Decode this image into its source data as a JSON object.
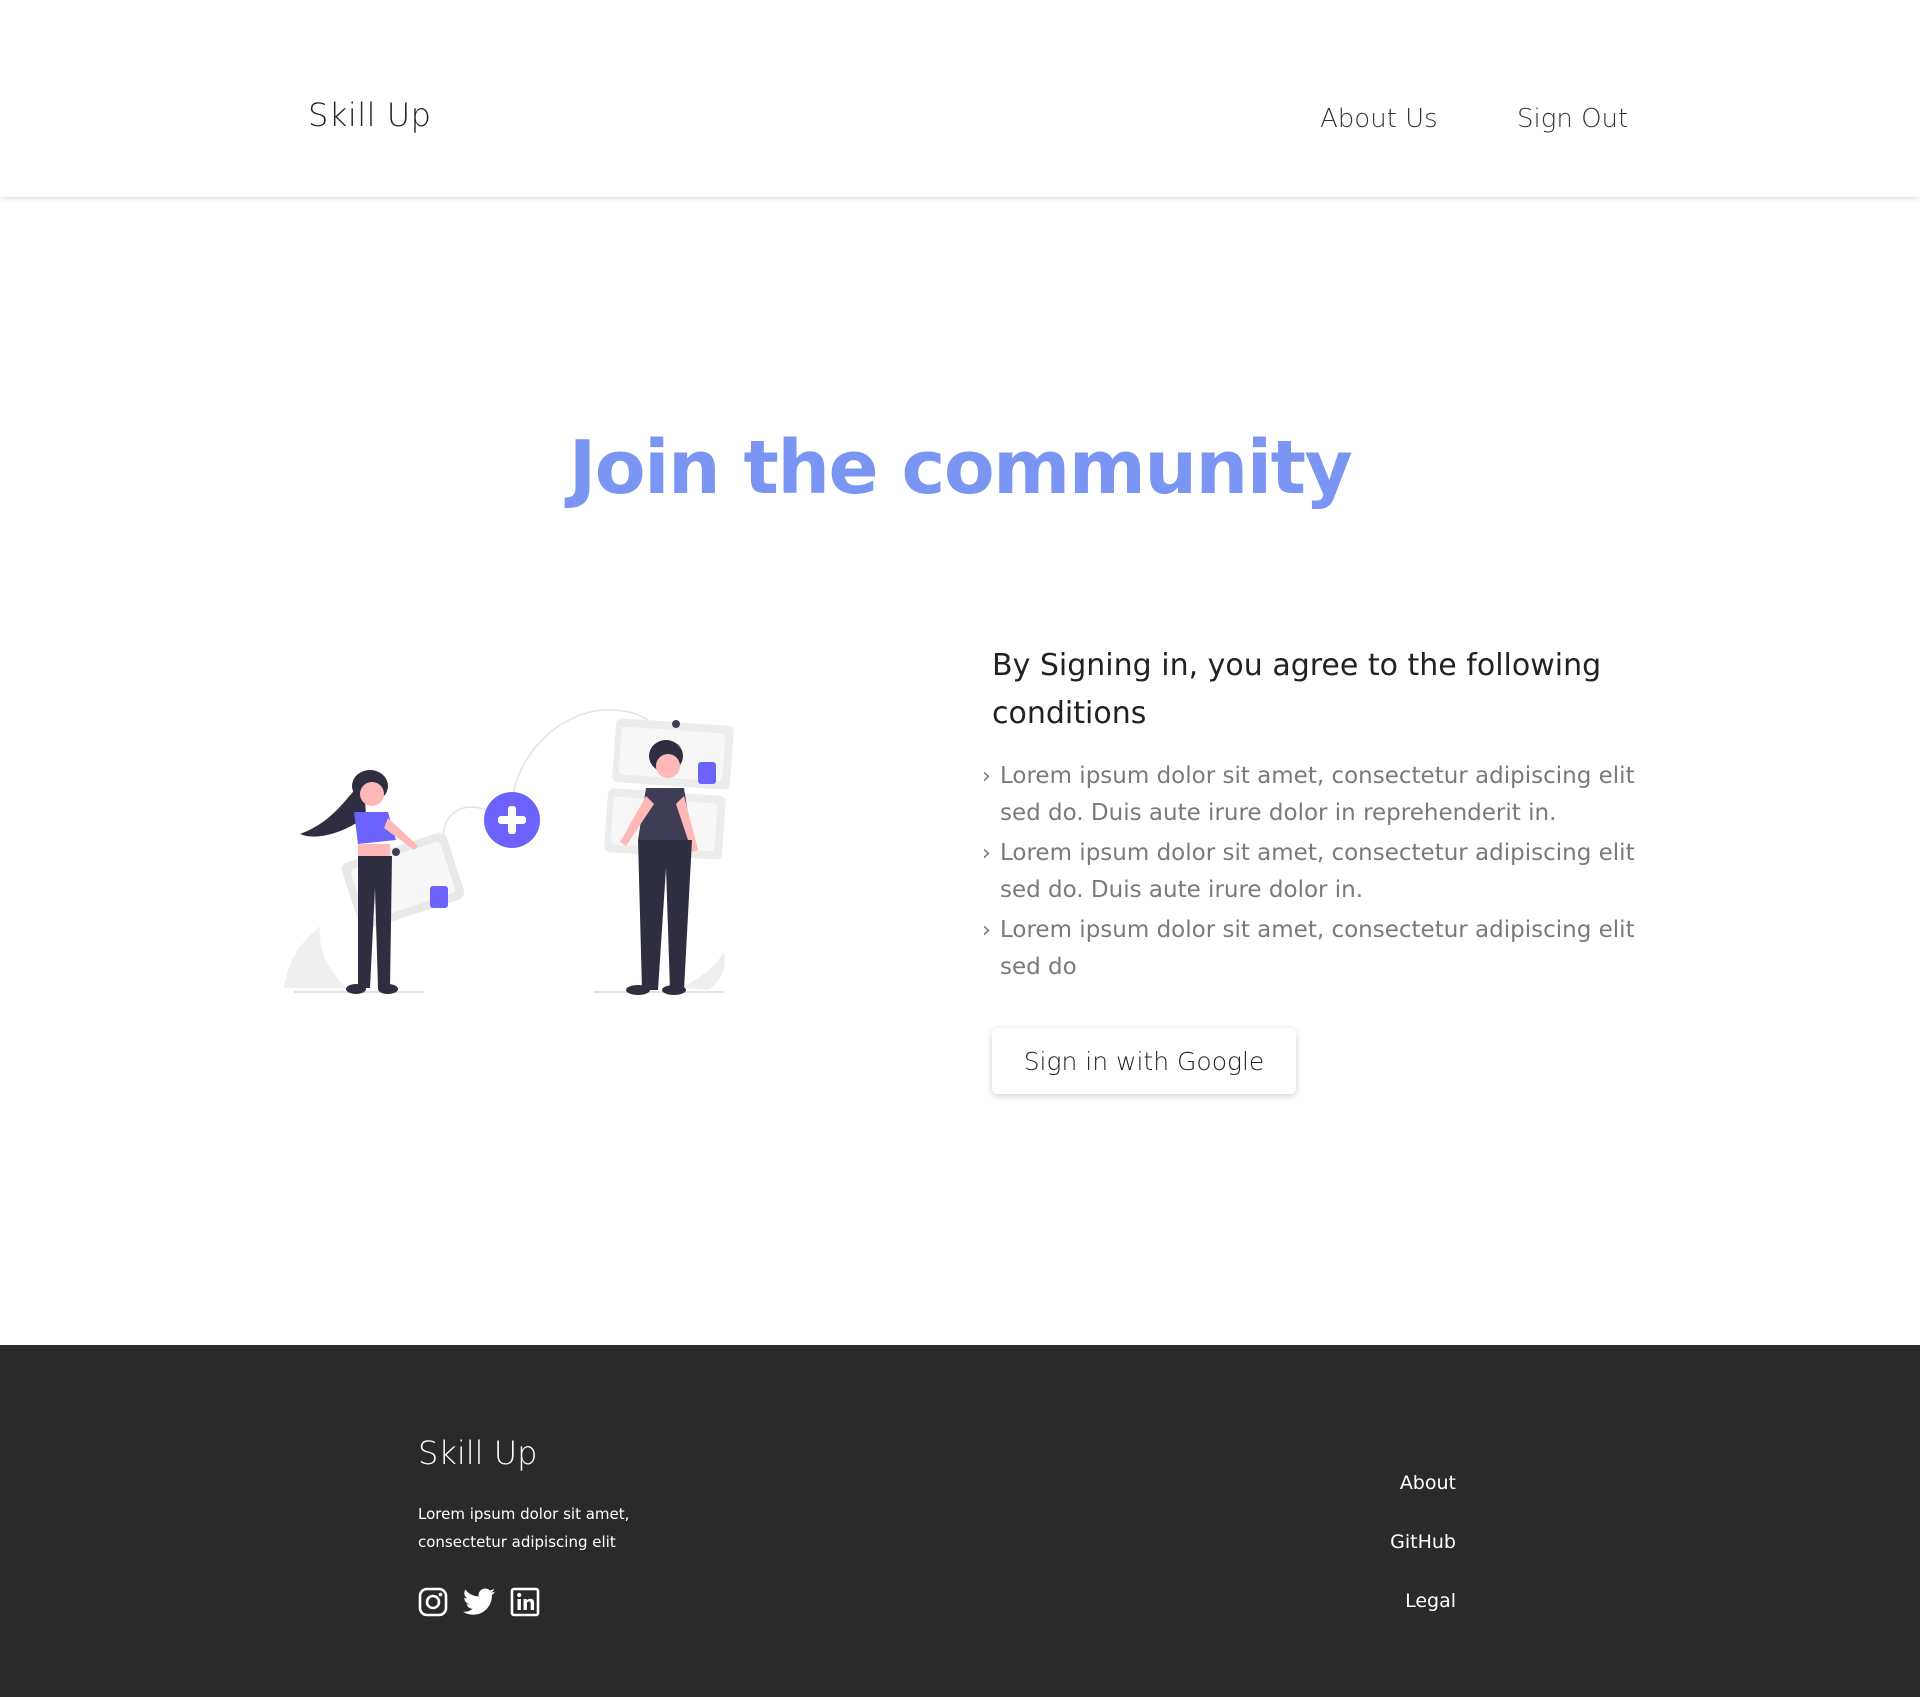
{
  "header": {
    "brand": "Skill Up",
    "nav": {
      "about": "About Us",
      "sign_out": "Sign Out"
    }
  },
  "hero": {
    "title": "Join the community"
  },
  "terms": {
    "heading": "By Signing in, you agree to the following conditions",
    "items": [
      "Lorem ipsum dolor sit amet, consectetur adipiscing elit sed do. Duis aute irure dolor in reprehenderit in.",
      "Lorem ipsum dolor sit amet, consectetur adipiscing elit sed do. Duis aute irure dolor in.",
      "Lorem ipsum dolor sit amet, consectetur adipiscing elit sed do"
    ],
    "bullet_icon": "chevron-right-icon"
  },
  "signin": {
    "button_label": "Sign in with Google"
  },
  "footer": {
    "brand": "Skill Up",
    "description": "Lorem ipsum dolor sit amet, consectetur adipiscing elit",
    "social": [
      "instagram-icon",
      "twitter-icon",
      "linkedin-icon"
    ],
    "links": {
      "about": "About",
      "github": "GitHub",
      "legal": "Legal"
    }
  },
  "colors": {
    "accent": "#7b96f2",
    "illustration_purple": "#6c63ff",
    "footer_bg": "#2a2a2a",
    "body_text": "#7a7a7a"
  }
}
